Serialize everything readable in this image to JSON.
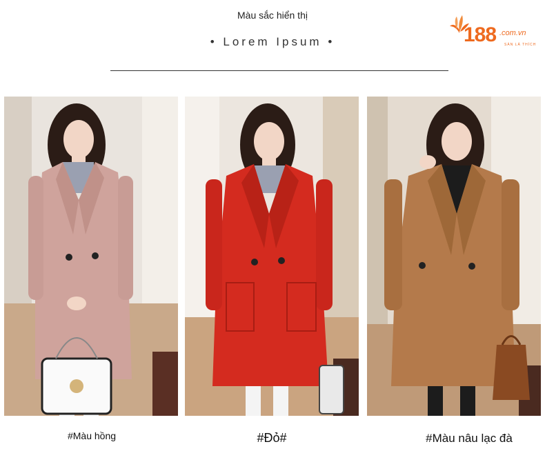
{
  "header": {
    "title": "Màu sắc hiển thị",
    "subtitle": "• Lorem Ipsum •"
  },
  "logo": {
    "number": "188",
    "domain": ".com.vn",
    "tagline": "SÀN LÀ THÍCH",
    "color": "#ee6a1f"
  },
  "products": [
    {
      "caption": "#Màu hồng",
      "coat_color": "#cfa39c",
      "wall_color": "#e8e2dc"
    },
    {
      "caption": "#Đỏ#",
      "coat_color": "#d42b1f",
      "wall_color": "#ece6df"
    },
    {
      "caption": "#Màu nâu lạc đà",
      "coat_color": "#b47a4b",
      "wall_color": "#e4dbd0"
    }
  ]
}
